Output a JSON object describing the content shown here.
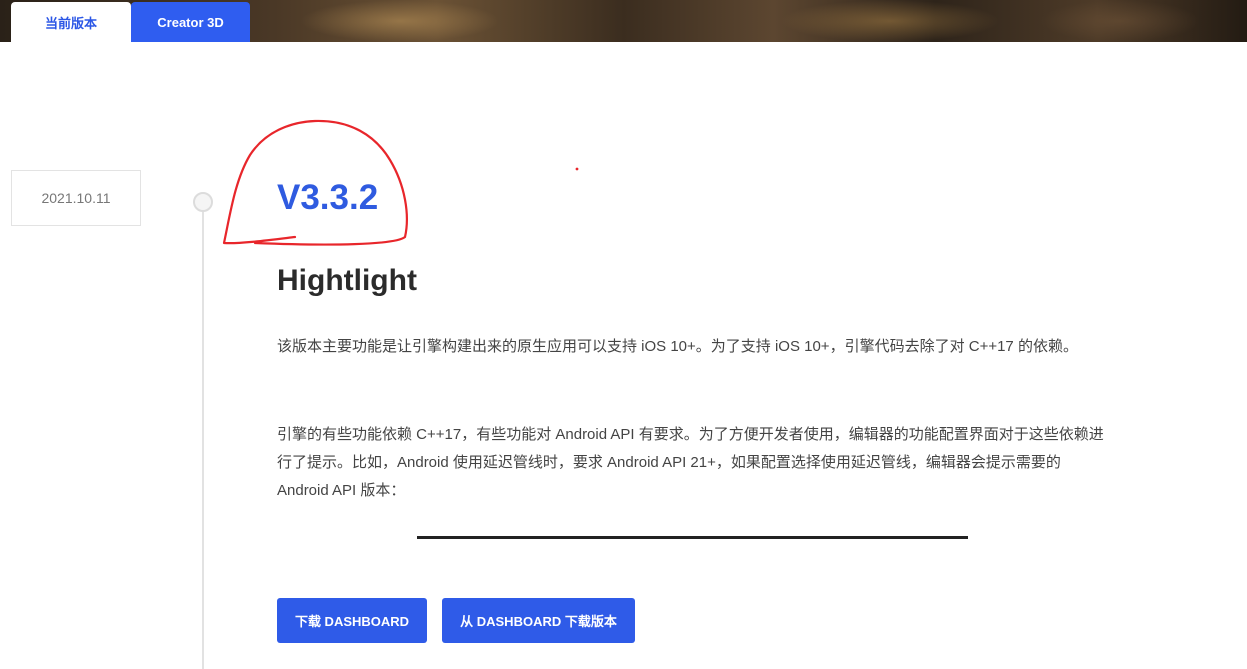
{
  "tabs": [
    {
      "label": "当前版本",
      "active": true
    },
    {
      "label": "Creator 3D",
      "active": false
    }
  ],
  "release": {
    "date": "2021.10.11",
    "version": "V3.3.2",
    "heading": "Hightlight",
    "paragraphs": [
      "该版本主要功能是让引擎构建出来的原生应用可以支持 iOS 10+。为了支持 iOS 10+，引擎代码去除了对 C++17 的依赖。",
      "引擎的有些功能依赖 C++17，有些功能对 Android API 有要求。为了方便开发者使用，编辑器的功能配置界面对于这些依赖进行了提示。比如，Android 使用延迟管线时，要求 Android API 21+，如果配置选择使用延迟管线，编辑器会提示需要的 Android API 版本："
    ]
  },
  "buttons": {
    "download": "下载 DASHBOARD",
    "from_dashboard": "从 DASHBOARD 下载版本"
  },
  "colors": {
    "accent": "#2f5be8",
    "annotation": "#e8262b"
  }
}
